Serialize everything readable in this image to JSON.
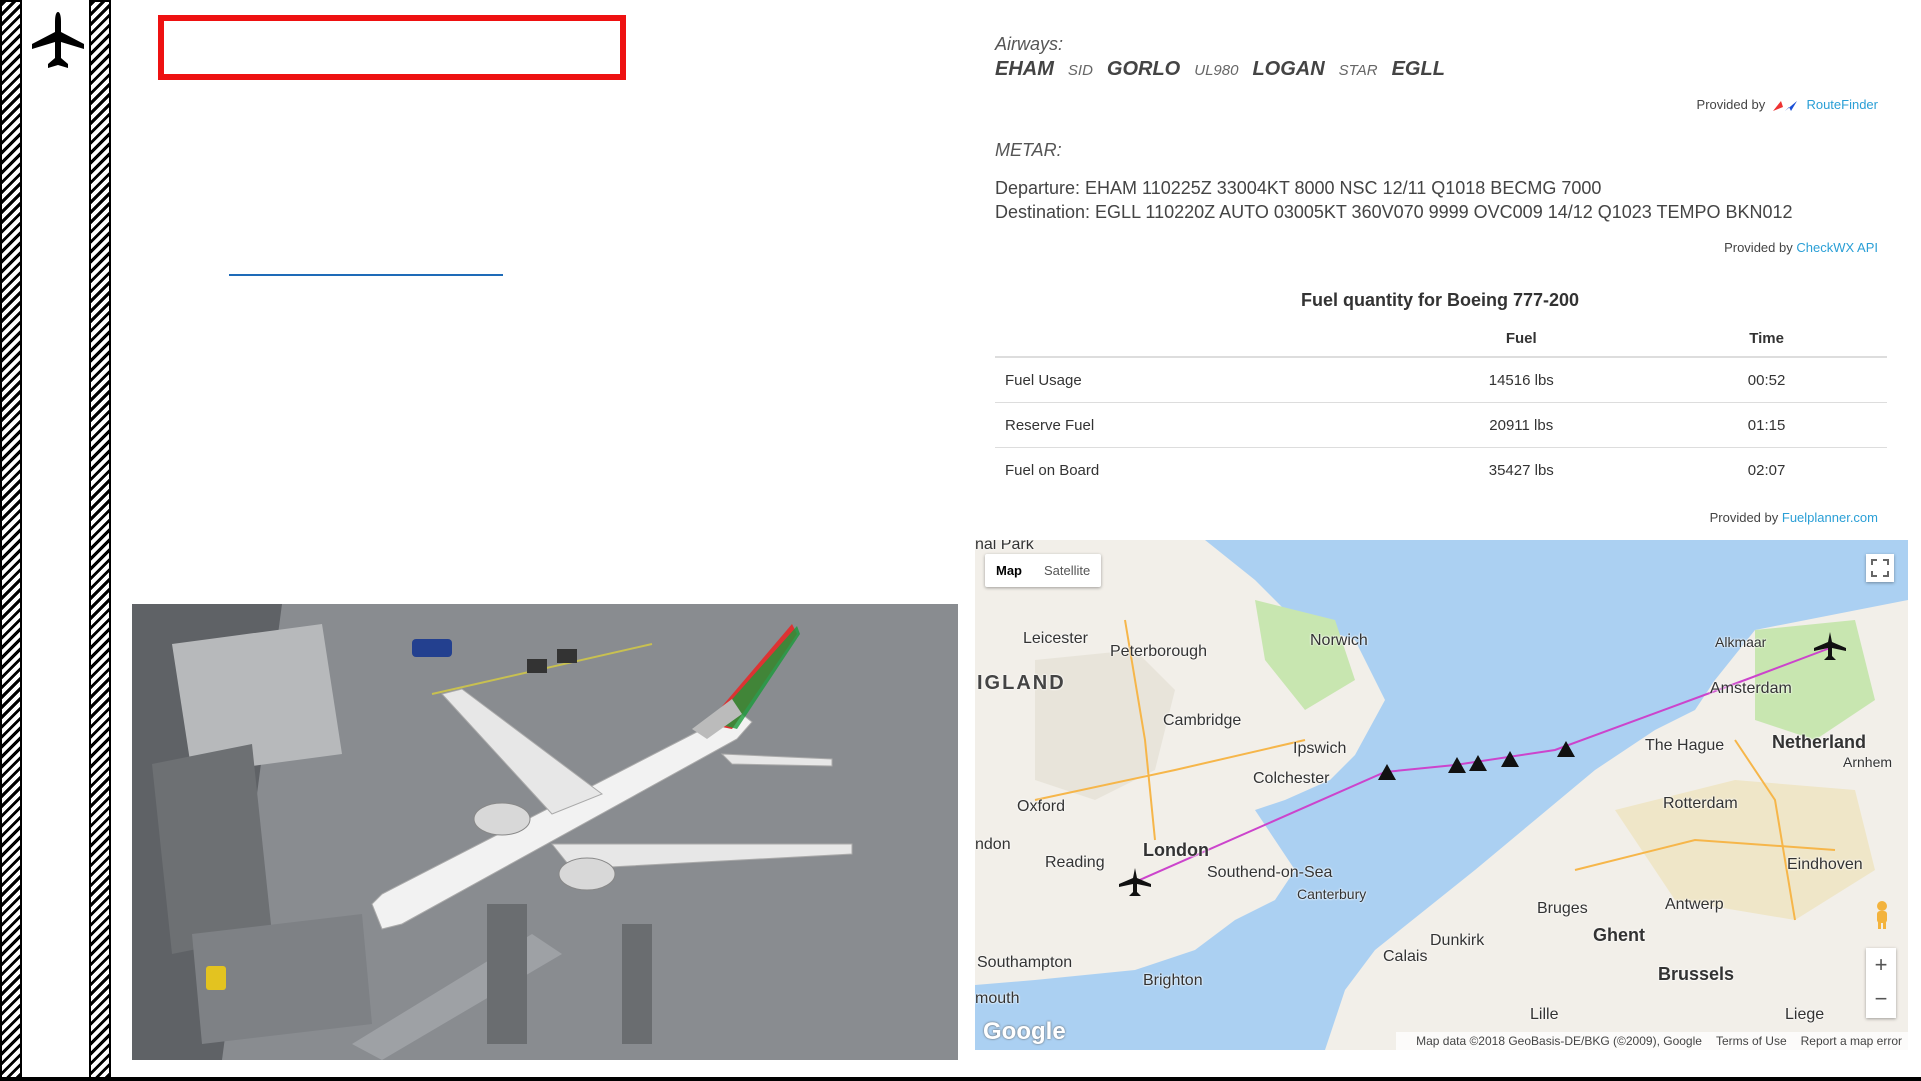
{
  "airways": {
    "label": "Airways:",
    "route": [
      {
        "text": "EHAM",
        "kind": "waypoint"
      },
      {
        "text": "SID",
        "kind": "airway"
      },
      {
        "text": "GORLO",
        "kind": "waypoint"
      },
      {
        "text": "UL980",
        "kind": "airway"
      },
      {
        "text": "LOGAN",
        "kind": "waypoint"
      },
      {
        "text": "STAR",
        "kind": "airway"
      },
      {
        "text": "EGLL",
        "kind": "waypoint"
      }
    ],
    "provided_prefix": "Provided by",
    "provided_link": "RouteFinder"
  },
  "metar": {
    "label": "METAR:",
    "departure": "Departure: EHAM 110225Z 33004KT 8000 NSC 12/11 Q1018 BECMG 7000",
    "destination": "Destination: EGLL 110220Z AUTO 03005KT 360V070 9999 OVC009 14/12 Q1023 TEMPO BKN012",
    "provided_prefix": "Provided by",
    "provided_link": "CheckWX API"
  },
  "fuel": {
    "title": "Fuel quantity for Boeing 777-200",
    "headers": [
      "",
      "Fuel",
      "Time"
    ],
    "rows": [
      [
        "Fuel Usage",
        "14516 lbs",
        "00:52"
      ],
      [
        "Reserve Fuel",
        "20911 lbs",
        "01:15"
      ],
      [
        "Fuel on Board",
        "35427 lbs",
        "02:07"
      ]
    ],
    "provided_prefix": "Provided by",
    "provided_link": "Fuelplanner.com"
  },
  "map": {
    "tab_map": "Map",
    "tab_satellite": "Satellite",
    "zoom_in": "+",
    "zoom_out": "−",
    "google": "Google",
    "attribution": "Map data ©2018 GeoBasis-DE/BKG (©2009), Google",
    "terms": "Terms of Use",
    "report": "Report a map error",
    "cities": [
      "nal Park",
      "Leicester",
      "Peterborough",
      "Norwich",
      "Alkmaar",
      "IGLAND",
      "Cambridge",
      "Amsterdam",
      "The Hague",
      "Netherland",
      "Ipswich",
      "Arnhem",
      "Colchester",
      "Oxford",
      "Rotterdam",
      "ndon",
      "London",
      "Reading",
      "Southend-on-Sea",
      "Eindhoven",
      "Canterbury",
      "Antwerp",
      "Bruges",
      "Ghent",
      "Dunkirk",
      "Calais",
      "Southampton",
      "Brussels",
      "Brighton",
      "mouth",
      "Lille",
      "Liege"
    ],
    "icons": {
      "fullscreen": "fullscreen-icon",
      "pegman": "pegman-icon",
      "aircraft": "aircraft-icon",
      "waypoint": "waypoint-triangle-icon"
    },
    "colors": {
      "water": "#abd0f2",
      "land": "#f2efe9",
      "route": "#cc44cc",
      "green": "#c8e6b0"
    }
  },
  "sidebar": {
    "logo_icon": "airplane-icon"
  },
  "colors": {
    "title_box_border": "#e11111",
    "link_line": "#1e6bb8",
    "provided_link": "#2a9fd6"
  }
}
